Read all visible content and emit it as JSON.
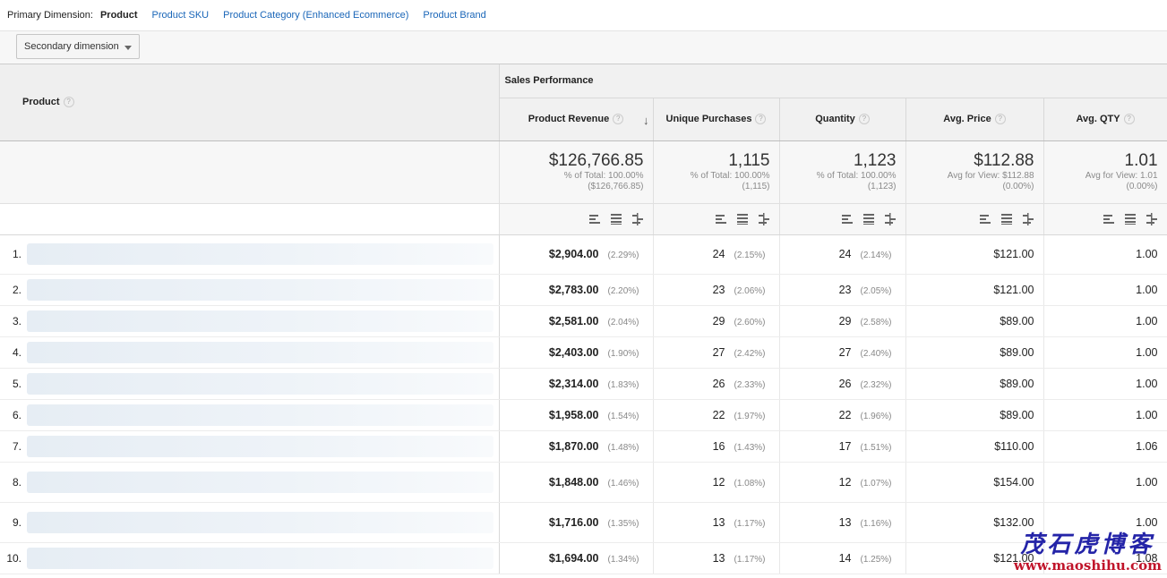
{
  "primary_dimension": {
    "label": "Primary Dimension:",
    "active": "Product",
    "links": [
      "Product SKU",
      "Product Category (Enhanced Ecommerce)",
      "Product Brand"
    ]
  },
  "toolbar": {
    "secondary_dimension": "Secondary dimension"
  },
  "table": {
    "dimension_header": "Product",
    "group_header": "Sales Performance",
    "columns": [
      "Product Revenue",
      "Unique Purchases",
      "Quantity",
      "Avg. Price",
      "Avg. QTY"
    ],
    "totals": [
      {
        "value": "$126,766.85",
        "line1": "% of Total: 100.00%",
        "line2": "($126,766.85)"
      },
      {
        "value": "1,115",
        "line1": "% of Total: 100.00%",
        "line2": "(1,115)"
      },
      {
        "value": "1,123",
        "line1": "% of Total: 100.00%",
        "line2": "(1,123)"
      },
      {
        "value": "$112.88",
        "line1": "Avg for View: $112.88",
        "line2": "(0.00%)"
      },
      {
        "value": "1.01",
        "line1": "Avg for View: 1.01",
        "line2": "(0.00%)"
      }
    ],
    "rows": [
      {
        "index": "1.",
        "revenue": "$2,904.00",
        "revenue_pct": "(2.29%)",
        "unique": "24",
        "unique_pct": "(2.15%)",
        "quantity": "24",
        "quantity_pct": "(2.14%)",
        "avg_price": "$121.00",
        "avg_qty": "1.00"
      },
      {
        "index": "2.",
        "revenue": "$2,783.00",
        "revenue_pct": "(2.20%)",
        "unique": "23",
        "unique_pct": "(2.06%)",
        "quantity": "23",
        "quantity_pct": "(2.05%)",
        "avg_price": "$121.00",
        "avg_qty": "1.00"
      },
      {
        "index": "3.",
        "revenue": "$2,581.00",
        "revenue_pct": "(2.04%)",
        "unique": "29",
        "unique_pct": "(2.60%)",
        "quantity": "29",
        "quantity_pct": "(2.58%)",
        "avg_price": "$89.00",
        "avg_qty": "1.00"
      },
      {
        "index": "4.",
        "revenue": "$2,403.00",
        "revenue_pct": "(1.90%)",
        "unique": "27",
        "unique_pct": "(2.42%)",
        "quantity": "27",
        "quantity_pct": "(2.40%)",
        "avg_price": "$89.00",
        "avg_qty": "1.00"
      },
      {
        "index": "5.",
        "revenue": "$2,314.00",
        "revenue_pct": "(1.83%)",
        "unique": "26",
        "unique_pct": "(2.33%)",
        "quantity": "26",
        "quantity_pct": "(2.32%)",
        "avg_price": "$89.00",
        "avg_qty": "1.00"
      },
      {
        "index": "6.",
        "revenue": "$1,958.00",
        "revenue_pct": "(1.54%)",
        "unique": "22",
        "unique_pct": "(1.97%)",
        "quantity": "22",
        "quantity_pct": "(1.96%)",
        "avg_price": "$89.00",
        "avg_qty": "1.00"
      },
      {
        "index": "7.",
        "revenue": "$1,870.00",
        "revenue_pct": "(1.48%)",
        "unique": "16",
        "unique_pct": "(1.43%)",
        "quantity": "17",
        "quantity_pct": "(1.51%)",
        "avg_price": "$110.00",
        "avg_qty": "1.06"
      },
      {
        "index": "8.",
        "revenue": "$1,848.00",
        "revenue_pct": "(1.46%)",
        "unique": "12",
        "unique_pct": "(1.08%)",
        "quantity": "12",
        "quantity_pct": "(1.07%)",
        "avg_price": "$154.00",
        "avg_qty": "1.00"
      },
      {
        "index": "9.",
        "revenue": "$1,716.00",
        "revenue_pct": "(1.35%)",
        "unique": "13",
        "unique_pct": "(1.17%)",
        "quantity": "13",
        "quantity_pct": "(1.16%)",
        "avg_price": "$132.00",
        "avg_qty": "1.00"
      },
      {
        "index": "10.",
        "revenue": "$1,694.00",
        "revenue_pct": "(1.34%)",
        "unique": "13",
        "unique_pct": "(1.17%)",
        "quantity": "14",
        "quantity_pct": "(1.25%)",
        "avg_price": "$121.00",
        "avg_qty": "1.08"
      }
    ]
  },
  "watermark": {
    "cn": "茂石虎博客",
    "url": "www.maoshihu.com"
  }
}
